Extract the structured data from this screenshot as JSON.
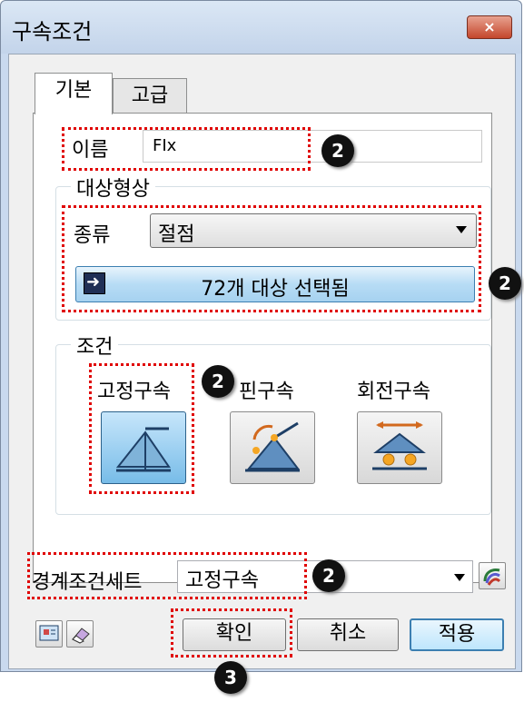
{
  "window": {
    "title": "구속조건",
    "close_label": "×"
  },
  "tabs": [
    {
      "label": "기본"
    },
    {
      "label": "고급"
    }
  ],
  "name": {
    "label": "이름",
    "value": "FIx"
  },
  "target_shape": {
    "legend": "대상형상",
    "kind_label": "종류",
    "kind_value": "절점",
    "select_button_label": "72개 대상 선택됨"
  },
  "condition": {
    "legend": "조건",
    "options": [
      {
        "label": "고정구속",
        "icon": "fixed-support-icon",
        "selected": true
      },
      {
        "label": "핀구속",
        "icon": "pin-support-icon",
        "selected": false
      },
      {
        "label": "회전구속",
        "icon": "roller-support-icon",
        "selected": false
      }
    ]
  },
  "boundary_set": {
    "label": "경계조건세트",
    "value": "고정구속"
  },
  "buttons": {
    "ok": "확인",
    "cancel": "취소",
    "apply": "적용"
  },
  "callouts": {
    "a": "2",
    "b": "2",
    "c": "2",
    "d": "2",
    "e": "3"
  },
  "colors": {
    "highlight": "#e00000",
    "selected_button": "#77bce8",
    "close_button": "#c4462b"
  }
}
